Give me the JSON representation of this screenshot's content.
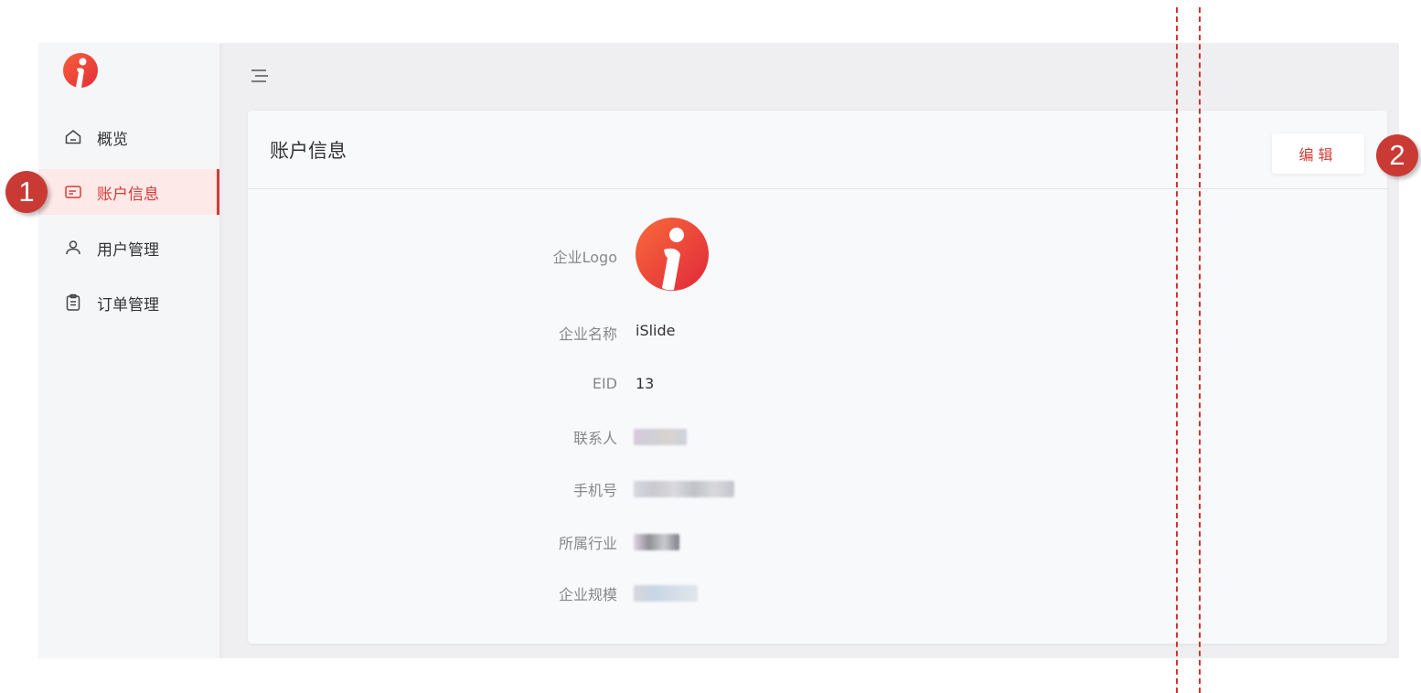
{
  "sidebar": {
    "logo_icon": "islide-logo-icon",
    "items": [
      {
        "label": "概览",
        "icon": "home-icon"
      },
      {
        "label": "账户信息",
        "icon": "card-icon",
        "active": true
      },
      {
        "label": "用户管理",
        "icon": "user-icon"
      },
      {
        "label": "订单管理",
        "icon": "clipboard-icon"
      }
    ]
  },
  "header": {
    "menu_icon": "menu-icon"
  },
  "card": {
    "title": "账户信息",
    "edit_label": "编辑",
    "fields": [
      {
        "label": "企业Logo",
        "value": "islide-logo-icon"
      },
      {
        "label": "企业名称",
        "value": "iSlide"
      },
      {
        "label": "EID",
        "value": "13"
      },
      {
        "label": "联系人",
        "value": ""
      },
      {
        "label": "手机号",
        "value": ""
      },
      {
        "label": "所属行业",
        "value": ""
      },
      {
        "label": "企业规模",
        "value": ""
      }
    ]
  },
  "annotations": {
    "badge_1": "1",
    "badge_2": "2"
  },
  "colors": {
    "accent": "#d33b35",
    "badge": "#c93a35",
    "active_bg": "#fde9e8"
  }
}
